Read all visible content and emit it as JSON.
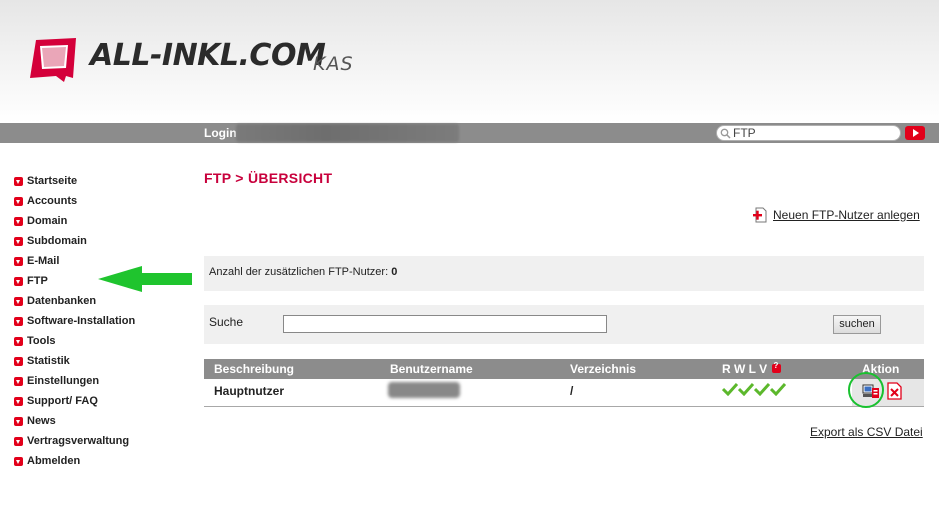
{
  "header": {
    "brand": "ALL-INKL.COM",
    "product": "KAS",
    "accent_color": "#e2001a"
  },
  "topbar": {
    "login_label": "Login",
    "search_value": "FTP",
    "search_icon": "magnifier-icon",
    "go_icon": "play-arrow-icon"
  },
  "sidebar": {
    "items": [
      {
        "label": "Startseite"
      },
      {
        "label": "Accounts"
      },
      {
        "label": "Domain"
      },
      {
        "label": "Subdomain"
      },
      {
        "label": "E-Mail"
      },
      {
        "label": "FTP"
      },
      {
        "label": "Datenbanken"
      },
      {
        "label": "Software-Installation"
      },
      {
        "label": "Tools"
      },
      {
        "label": "Statistik"
      },
      {
        "label": "Einstellungen"
      },
      {
        "label": "Support/ FAQ"
      },
      {
        "label": "News"
      },
      {
        "label": "Vertragsverwaltung"
      },
      {
        "label": "Abmelden"
      }
    ]
  },
  "main": {
    "title": "FTP > ÜBERSICHT",
    "new_user_link": "Neuen FTP-Nutzer anlegen",
    "count_label": "Anzahl der zusätzlichen FTP-Nutzer:",
    "count_value": "0",
    "search": {
      "label": "Suche",
      "value": "",
      "button": "suchen"
    },
    "table": {
      "columns": [
        "Beschreibung",
        "Benutzername",
        "Verzeichnis",
        "R W L V",
        "Aktion"
      ],
      "rows": [
        {
          "description": "Hauptnutzer",
          "directory": "/",
          "permissions_icon": "checkmark-icon"
        }
      ]
    },
    "export_link": "Export als CSV Datei"
  }
}
